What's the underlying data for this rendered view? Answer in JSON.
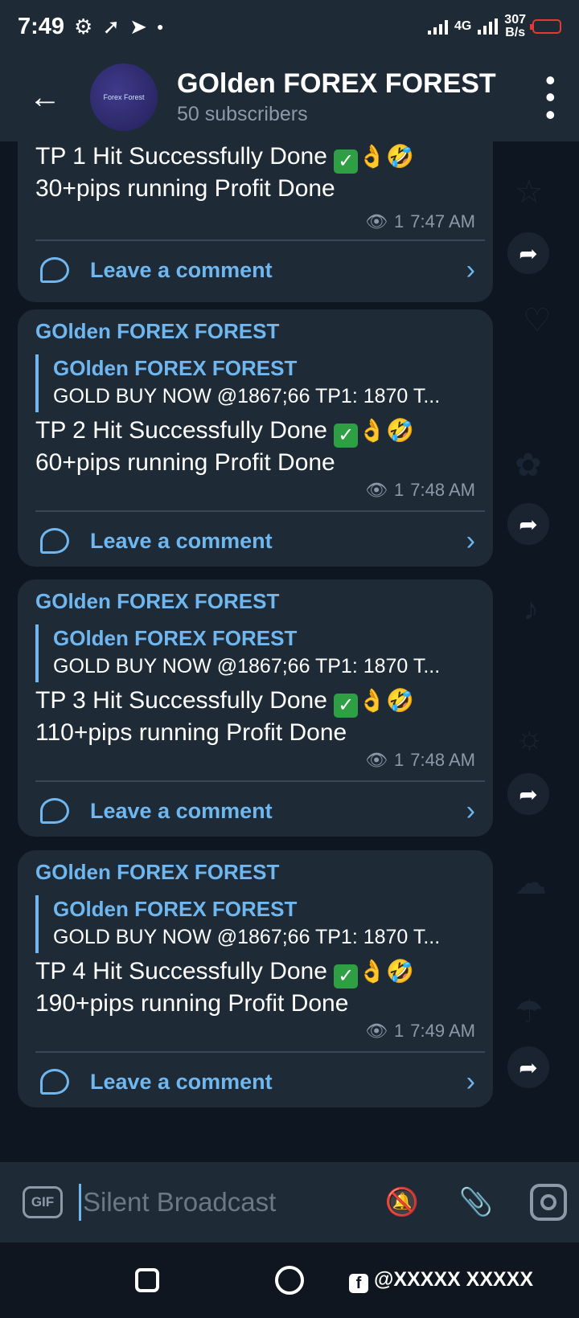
{
  "status_bar": {
    "time": "7:49",
    "net_speed_value": "307",
    "net_speed_unit": "B/s",
    "network_type": "4G"
  },
  "header": {
    "title": "GOlden FOREX FOREST",
    "subtitle": "50 subscribers",
    "avatar_text": "Forex Forest"
  },
  "messages": [
    {
      "author": "",
      "quote_author": "",
      "quote_text": "",
      "line1": "TP 1 Hit Successfully Done",
      "line2": "30+pips running Profit Done",
      "views": "1",
      "time": "7:47 AM",
      "comment_label": "Leave a comment"
    },
    {
      "author": "GOlden FOREX FOREST",
      "quote_author": "GOlden FOREX FOREST",
      "quote_text": "GOLD BUY NOW   @1867;66  TP1: 1870 T...",
      "line1": "TP 2 Hit Successfully Done",
      "line2": "60+pips running Profit Done",
      "views": "1",
      "time": "7:48 AM",
      "comment_label": "Leave a comment"
    },
    {
      "author": "GOlden FOREX FOREST",
      "quote_author": "GOlden FOREX FOREST",
      "quote_text": "GOLD BUY NOW   @1867;66  TP1: 1870 T...",
      "line1": "TP 3 Hit Successfully Done",
      "line2": "110+pips running Profit Done",
      "views": "1",
      "time": "7:48 AM",
      "comment_label": "Leave a comment"
    },
    {
      "author": "GOlden FOREX FOREST",
      "quote_author": "GOlden FOREX FOREST",
      "quote_text": "GOLD BUY NOW   @1867;66  TP1: 1870 T...",
      "line1": "TP 4 Hit Successfully Done",
      "line2": "190+pips running Profit Done",
      "views": "1",
      "time": "7:49 AM",
      "comment_label": "Leave a comment"
    }
  ],
  "emojis": {
    "check": "✓",
    "ok_hand": "👌",
    "rofl": "🤣"
  },
  "input": {
    "gif_label": "GIF",
    "placeholder": "Silent Broadcast"
  },
  "watermark": "@XXXXX XXXXX",
  "colors": {
    "accent": "#70b7f0",
    "bubble": "#1e2a36",
    "background": "#0e1621",
    "battery_low": "#e53935"
  }
}
